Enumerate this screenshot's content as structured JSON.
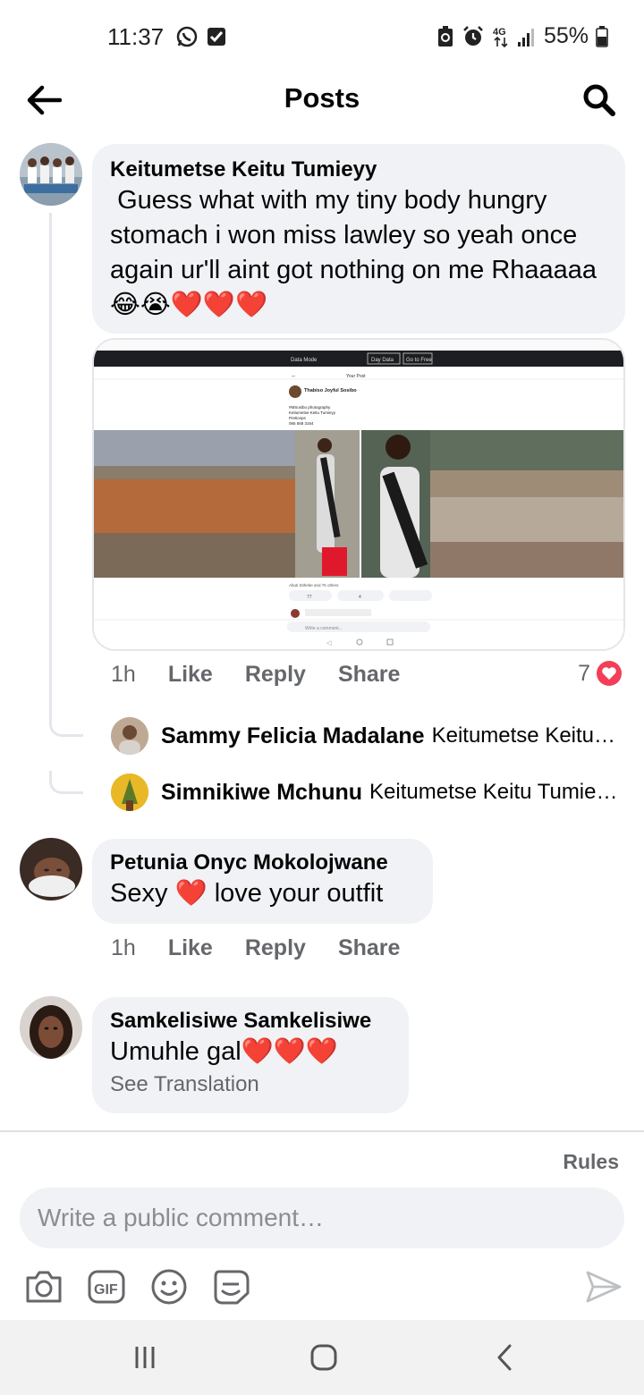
{
  "status_bar": {
    "time": "11:37",
    "battery": "55%",
    "network": "4G",
    "icons": [
      "whatsapp-icon",
      "check-box-icon",
      "battery-saver-icon",
      "alarm-icon",
      "network-4g-icon",
      "signal-icon",
      "battery-icon"
    ]
  },
  "header": {
    "title": "Posts",
    "back_icon": "arrow-left-icon",
    "search_icon": "search-icon"
  },
  "comments": [
    {
      "author": "Keitumetse Keitu Tumieyy",
      "text": " Guess what with my tiny body hungry stomach i won miss lawley so yeah once again ur'll aint got nothing on me Rhaaaaa😂😭❤️❤️❤️",
      "time": "1h",
      "like": "Like",
      "reply": "Reply",
      "share": "Share",
      "reaction_count": "7",
      "attachment": {
        "top_bar": "Data Mode",
        "btn_day": "Day Data",
        "btn_free": "Go to Free",
        "post_header": "Your Post",
        "post_author": "Thabiso Joyful Sosibo",
        "post_lines": [
          "#MSosibo photography",
          "Keitumetse Keitu Tumieyy",
          "Preticeps",
          "065 568 3164"
        ],
        "reactions_line": "Abuti Sithebe and 76 others",
        "btn_like": "77",
        "btn_comment": "4",
        "write_comment": "Write a comment..."
      },
      "replies": [
        {
          "name": "Sammy Felicia Madalane",
          "text": "Keitumetse Keitu…"
        },
        {
          "name": "Simnikiwe Mchunu",
          "text": "Keitumetse Keitu Tumie…"
        }
      ]
    },
    {
      "author": "Petunia Onyc Mokolojwane",
      "text": "Sexy ❤️ love your outfit",
      "time": "1h",
      "like": "Like",
      "reply": "Reply",
      "share": "Share"
    },
    {
      "author": "Samkelisiwe Samkelisiwe",
      "text": "Umuhle gal❤️❤️❤️",
      "see_translation": "See Translation"
    }
  ],
  "composer": {
    "rules": "Rules",
    "placeholder": "Write a public comment…",
    "tools": [
      "camera-icon",
      "gif-icon",
      "emoji-icon",
      "sticker-icon"
    ],
    "send_icon": "send-icon"
  },
  "colors": {
    "bubble": "#f0f2f5",
    "muted_text": "#65676b",
    "heart_red": "#f33e58"
  }
}
